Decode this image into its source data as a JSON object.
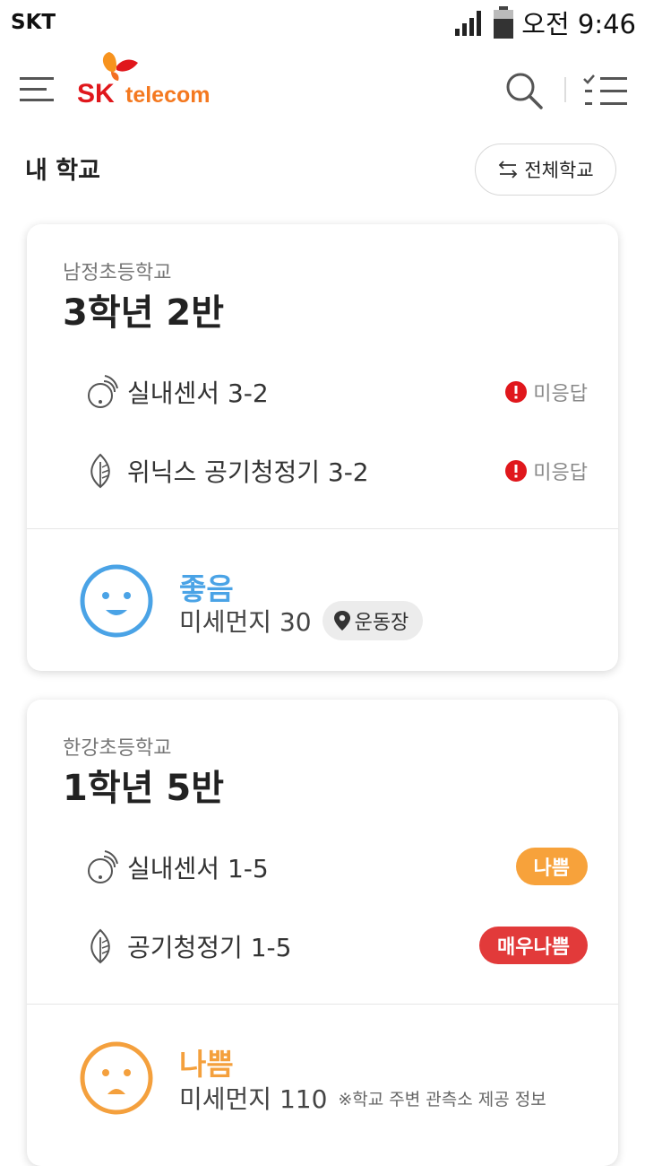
{
  "status_bar": {
    "carrier": "SKT",
    "time": "오전 9:46"
  },
  "header": {
    "logo_text_sk": "SK",
    "logo_text_telecom": "telecom"
  },
  "section": {
    "title": "내 학교",
    "all_schools_label": "전체학교"
  },
  "cards": [
    {
      "school": "남정초등학교",
      "class": "3학년 2반",
      "devices": [
        {
          "name": "실내센서 3-2",
          "status": "미응답",
          "icon": "sensor-icon"
        },
        {
          "name": "위닉스 공기청정기 3-2",
          "status": "미응답",
          "icon": "air-purifier-icon"
        }
      ],
      "air": {
        "label": "좋음",
        "value": "미세먼지 30",
        "location": "운동장",
        "color": "#4aa3e6"
      }
    },
    {
      "school": "한강초등학교",
      "class": "1학년 5반",
      "devices": [
        {
          "name": "실내센서 1-5",
          "status": "나쁨",
          "status_color": "#f7a23b",
          "icon": "sensor-icon"
        },
        {
          "name": "공기청정기 1-5",
          "status": "매우나쁨",
          "status_color": "#e23a3a",
          "icon": "air-purifier-icon"
        }
      ],
      "air": {
        "label": "나쁨",
        "value": "미세먼지 110",
        "note": "※학교 주변 관측소 제공 정보",
        "color": "#f4a03d"
      }
    }
  ],
  "colors": {
    "accent_red": "#e0171c",
    "accent_orange": "#f47920",
    "no_response": "#e0171c"
  }
}
